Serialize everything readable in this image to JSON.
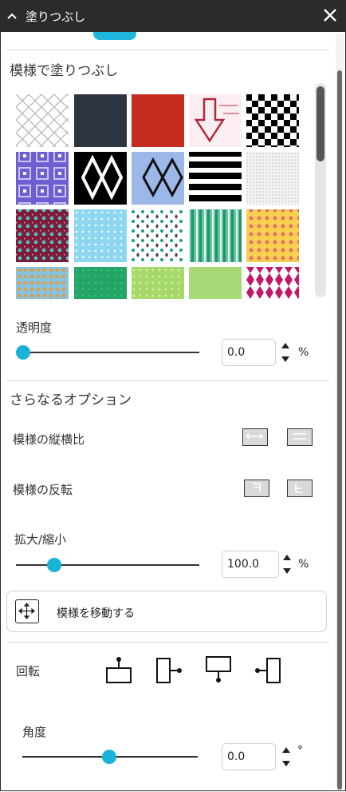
{
  "titlebar": {
    "title": "塗りつぶし"
  },
  "pattern_section": {
    "title": "模様で塗りつぶし"
  },
  "swatches": [
    {
      "name": "diamond-lattice"
    },
    {
      "name": "dark-denim"
    },
    {
      "name": "red-texture"
    },
    {
      "name": "red-arrows"
    },
    {
      "name": "checkerboard"
    },
    {
      "name": "purple-blocks"
    },
    {
      "name": "black-diamonds"
    },
    {
      "name": "blue-diamonds"
    },
    {
      "name": "black-stripes"
    },
    {
      "name": "gray-dots"
    },
    {
      "name": "maroon-dots"
    },
    {
      "name": "light-blue-dots"
    },
    {
      "name": "teal-diamond-dots"
    },
    {
      "name": "green-stripes"
    },
    {
      "name": "yellow-dots"
    },
    {
      "name": "orange-blue-dots"
    },
    {
      "name": "green-dots"
    },
    {
      "name": "light-green-dots"
    },
    {
      "name": "lime-green"
    },
    {
      "name": "pink-harlequin"
    }
  ],
  "opacity": {
    "label": "透明度",
    "value": "0.0",
    "unit": "%"
  },
  "more_options": {
    "title": "さらなるオプション"
  },
  "aspect": {
    "label": "模様の縦横比"
  },
  "flip": {
    "label": "模様の反転"
  },
  "scale": {
    "label": "拡大/縮小",
    "value": "100.0",
    "unit": "%"
  },
  "move": {
    "label": "模様を移動する"
  },
  "rotate": {
    "label": "回転"
  },
  "angle": {
    "label": "角度",
    "value": "0.0",
    "unit": "°"
  },
  "colors": {
    "accent": "#19b3d8",
    "titlebar": "#2b2b2b"
  }
}
